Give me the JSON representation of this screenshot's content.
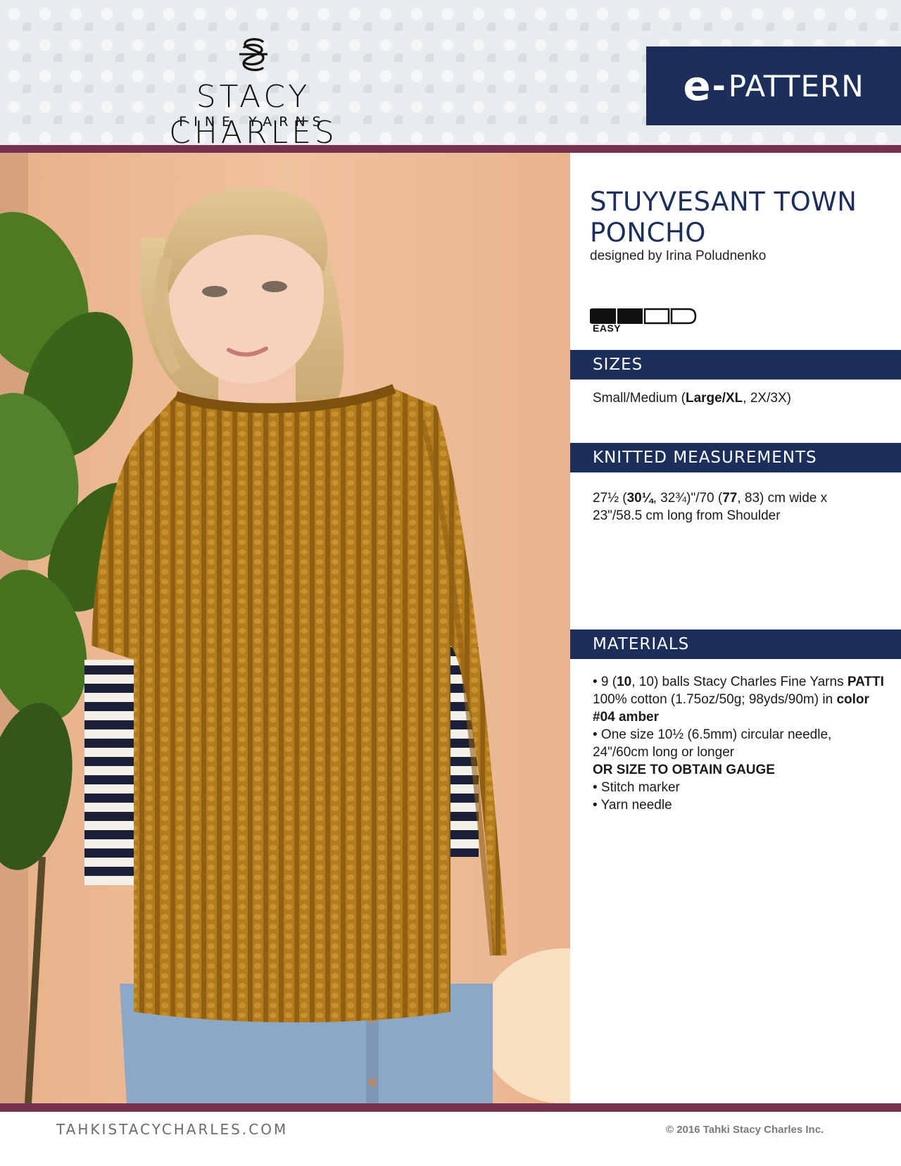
{
  "header": {
    "brand_name": "STACY CHARLES",
    "brand_sub": "FINE YARNS",
    "epattern_e": "e",
    "epattern_dash": "-",
    "epattern_word": "PATTERN"
  },
  "pattern": {
    "title": "STUYVESANT TOWN PONCHO",
    "designer": "designed by Irina Poludnenko",
    "skill_level": "EASY",
    "skill_filled": 2,
    "skill_total": 4
  },
  "sections": {
    "sizes_heading": "SIZES",
    "sizes": [
      "Small/Medium (",
      "Large/XL",
      ", 2X/3X)"
    ],
    "measurements_heading": "KNITTED MEASUREMENTS",
    "measurements": [
      "27½ (",
      "30¼",
      ", 32¾)\"/70 (",
      "77",
      ", 83) cm wide x",
      "23\"/58.5 cm long from Shoulder"
    ],
    "materials_heading": "MATERIALS",
    "materials": {
      "item1": [
        "• 9 (",
        "10",
        ", 10) balls Stacy Charles Fine Yarns ",
        "PATTI",
        " 100% cotton (1.75oz/50g; 98yds/90m) in ",
        "color #04 amber"
      ],
      "item2": "• One size 10½ (6.5mm) circular needle, 24\"/60cm long or longer",
      "gauge": "OR SIZE TO OBTAIN GAUGE",
      "item3": "• Stitch marker",
      "item4": "• Yarn needle"
    }
  },
  "footer": {
    "url": "TAHKISTACYCHARLES.COM",
    "copyright": "© 2016 Tahki Stacy Charles Inc."
  },
  "colors": {
    "navy": "#1c2f5a",
    "plum_rule": "#76314d",
    "poncho_amber": "#b8801f"
  }
}
